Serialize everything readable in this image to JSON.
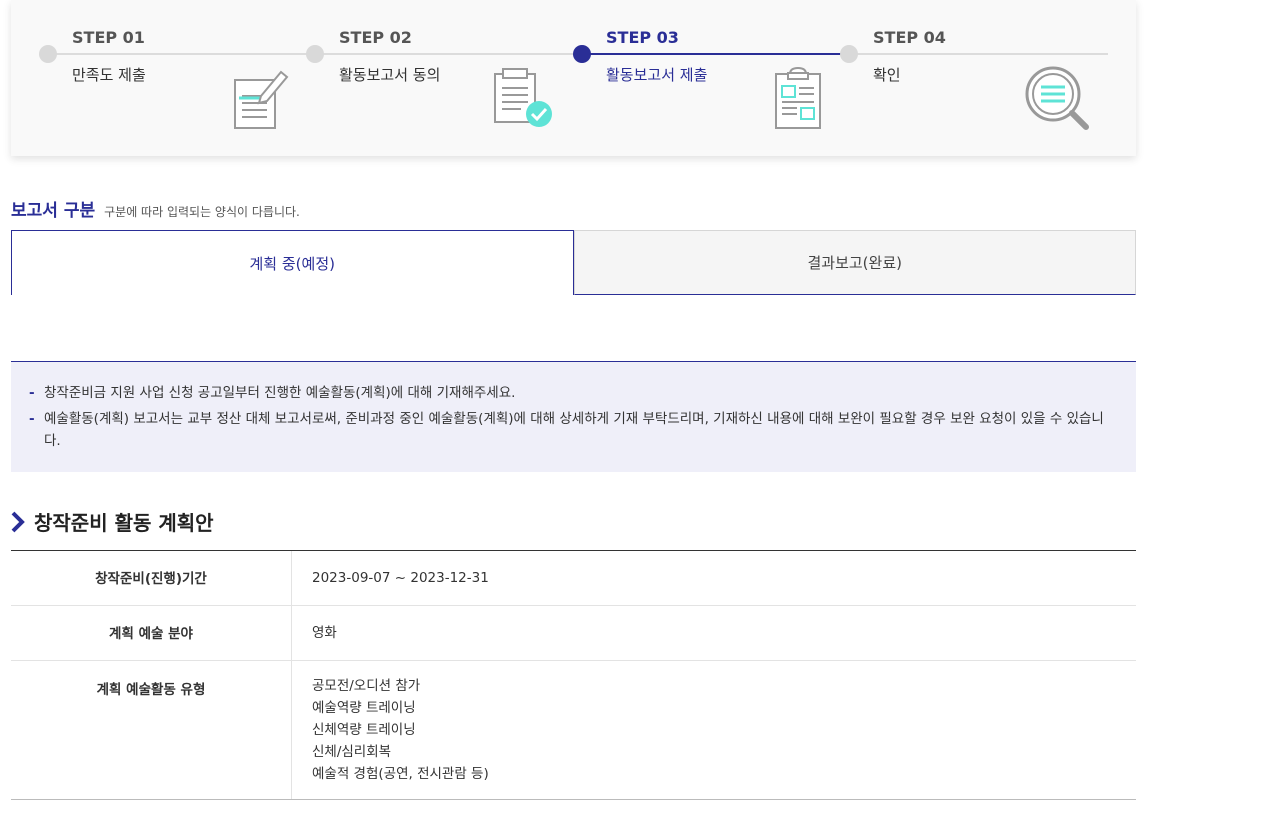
{
  "steps": [
    {
      "num": "STEP 01",
      "label": "만족도 제출",
      "icon": "edit-document-icon",
      "active": false
    },
    {
      "num": "STEP 02",
      "label": "활동보고서 동의",
      "icon": "clipboard-check-icon",
      "active": false
    },
    {
      "num": "STEP 03",
      "label": "활동보고서 제출",
      "icon": "clipboard-form-icon",
      "active": true
    },
    {
      "num": "STEP 04",
      "label": "확인",
      "icon": "magnifier-icon",
      "active": false
    }
  ],
  "report_type": {
    "title": "보고서 구분",
    "desc": "구분에 따라 입력되는 양식이 다릅니다.",
    "tabs": [
      {
        "label": "계획 중(예정)",
        "active": true
      },
      {
        "label": "결과보고(완료)",
        "active": false
      }
    ]
  },
  "notice": {
    "items": [
      "창작준비금 지원 사업 신청 공고일부터 진행한 예술활동(계획)에 대해 기재해주세요.",
      "예술활동(계획) 보고서는 교부 정산 대체 보고서로써, 준비과정 중인 예술활동(계획)에 대해 상세하게 기재 부탁드리며, 기재하신 내용에 대해 보완이 필요할 경우 보완 요청이 있을 수 있습니다."
    ]
  },
  "plan": {
    "title": "창작준비 활동 계획안",
    "rows": [
      {
        "header": "창작준비(진행)기간",
        "values": [
          "2023-09-07 ~ 2023-12-31"
        ]
      },
      {
        "header": "계획 예술 분야",
        "values": [
          "영화"
        ]
      },
      {
        "header": "계획 예술활동 유형",
        "values": [
          "공모전/오디션 참가",
          "예술역량 트레이닝",
          "신체역량 트레이닝",
          "신체/심리회복",
          "예술적 경험(공연, 전시관람 등)"
        ]
      }
    ]
  },
  "colors": {
    "accent": "#2a2e96",
    "mint": "#5ee3d6"
  }
}
